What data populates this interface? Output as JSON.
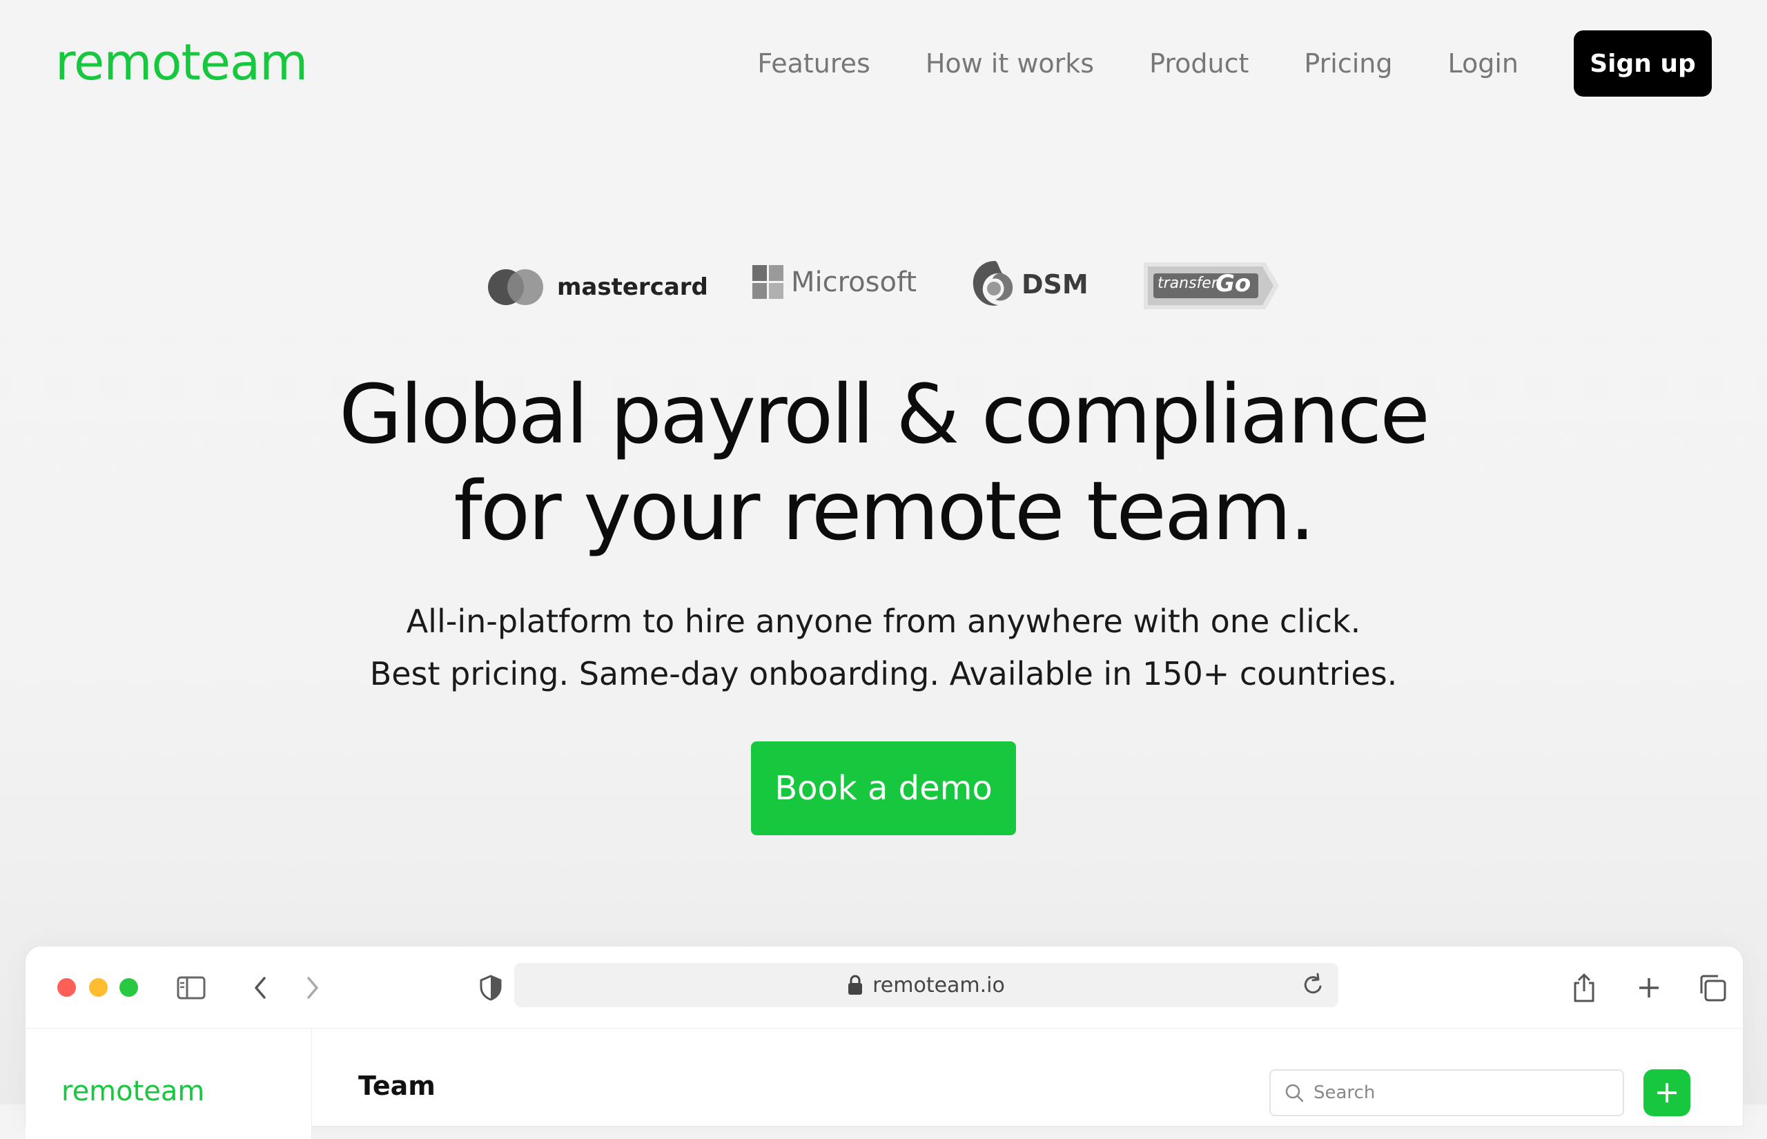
{
  "brand": {
    "name": "remoteam",
    "color": "#17c83f"
  },
  "nav": {
    "links": [
      "Features",
      "How it works",
      "Product",
      "Pricing",
      "Login"
    ],
    "signup_label": "Sign up"
  },
  "logos": {
    "mastercard": "mastercard",
    "microsoft": "Microsoft",
    "dsm": "DSM",
    "transfergo_a": "transfer",
    "transfergo_b": "Go"
  },
  "hero": {
    "headline_line1": "Global payroll & compliance",
    "headline_line2": "for your remote team.",
    "sub_line1": "All-in-platform to hire anyone from anywhere with one click.",
    "sub_line2": "Best pricing. Same-day onboarding. Available in 150+ countries.",
    "cta_label": "Book a demo"
  },
  "browser": {
    "address": "remoteam.io",
    "toolbar_icons": [
      "sidebar-icon",
      "back-icon",
      "forward-icon",
      "shield-icon",
      "share-icon",
      "plus-icon",
      "tabs-icon"
    ]
  },
  "app": {
    "brand": "remoteam",
    "page_title": "Team",
    "search_placeholder": "Search"
  },
  "colors": {
    "accent": "#17c83f",
    "dark_button": "#000000",
    "traffic_red": "#fe5f57",
    "traffic_yellow": "#febc2e",
    "traffic_green": "#28c840"
  }
}
